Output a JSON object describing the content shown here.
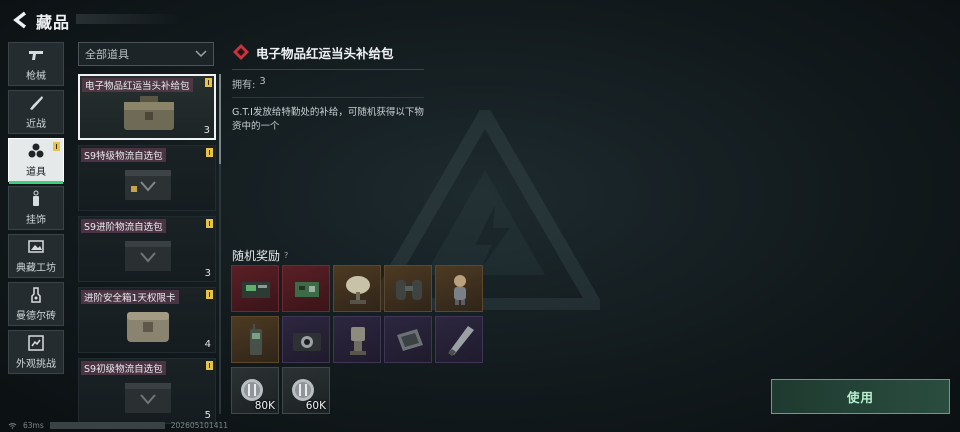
{
  "header": {
    "title": "藏品"
  },
  "sidebar": {
    "items": [
      {
        "label": "枪械",
        "icon": "gun-icon",
        "active": false,
        "badge": false
      },
      {
        "label": "近战",
        "icon": "knife-icon",
        "active": false,
        "badge": false
      },
      {
        "label": "道具",
        "icon": "items-icon",
        "active": true,
        "badge": true
      },
      {
        "label": "挂饰",
        "icon": "charm-icon",
        "active": false,
        "badge": false
      },
      {
        "label": "典藏工坊",
        "icon": "workshop-icon",
        "active": false,
        "badge": false
      },
      {
        "label": "曼德尔砖",
        "icon": "brick-icon",
        "active": false,
        "badge": false
      },
      {
        "label": "外观挑战",
        "icon": "challenge-icon",
        "active": false,
        "badge": false
      }
    ]
  },
  "filter": {
    "value": "全部道具"
  },
  "items": [
    {
      "name": "电子物品红运当头补给包",
      "qty": "3",
      "badge": true,
      "selected": true
    },
    {
      "name": "S9特级物流自选包",
      "qty": "",
      "badge": true,
      "selected": false
    },
    {
      "name": "S9进阶物流自选包",
      "qty": "3",
      "badge": true,
      "selected": false
    },
    {
      "name": "进阶安全箱1天权限卡",
      "qty": "4",
      "badge": true,
      "selected": false
    },
    {
      "name": "S9初级物流自选包",
      "qty": "5",
      "badge": true,
      "selected": false
    }
  ],
  "detail": {
    "title": "电子物品红运当头补给包",
    "owned_label": "拥有:",
    "owned_value": "3",
    "description": "G.T.I发放给特勤处的补给，可随机获得以下物资中的一个"
  },
  "rewards": {
    "title": "随机奖励",
    "help": "?",
    "items": [
      {
        "icon": "electronics-icon",
        "rarity": "red",
        "amount": ""
      },
      {
        "icon": "circuit-board-icon",
        "rarity": "red",
        "amount": ""
      },
      {
        "icon": "satellite-dish-icon",
        "rarity": "gold",
        "amount": ""
      },
      {
        "icon": "binoculars-icon",
        "rarity": "gold",
        "amount": ""
      },
      {
        "icon": "figurine-icon",
        "rarity": "gold",
        "amount": ""
      },
      {
        "icon": "radio-icon",
        "rarity": "gold",
        "amount": ""
      },
      {
        "icon": "camera-icon",
        "rarity": "purple",
        "amount": ""
      },
      {
        "icon": "statue-icon",
        "rarity": "purple",
        "amount": ""
      },
      {
        "icon": "device-icon",
        "rarity": "purple",
        "amount": ""
      },
      {
        "icon": "knife-blade-icon",
        "rarity": "purple",
        "amount": ""
      },
      {
        "icon": "coin-icon",
        "rarity": "gray",
        "amount": "80K"
      },
      {
        "icon": "coin-icon",
        "rarity": "gray",
        "amount": "60K"
      }
    ]
  },
  "actions": {
    "use_label": "使用"
  },
  "status": {
    "ping": "63ms",
    "id": "202605101411"
  },
  "colors": {
    "accent_green": "#3ad17a",
    "badge_yellow": "#e7c445",
    "use_border": "#5fa37f"
  }
}
